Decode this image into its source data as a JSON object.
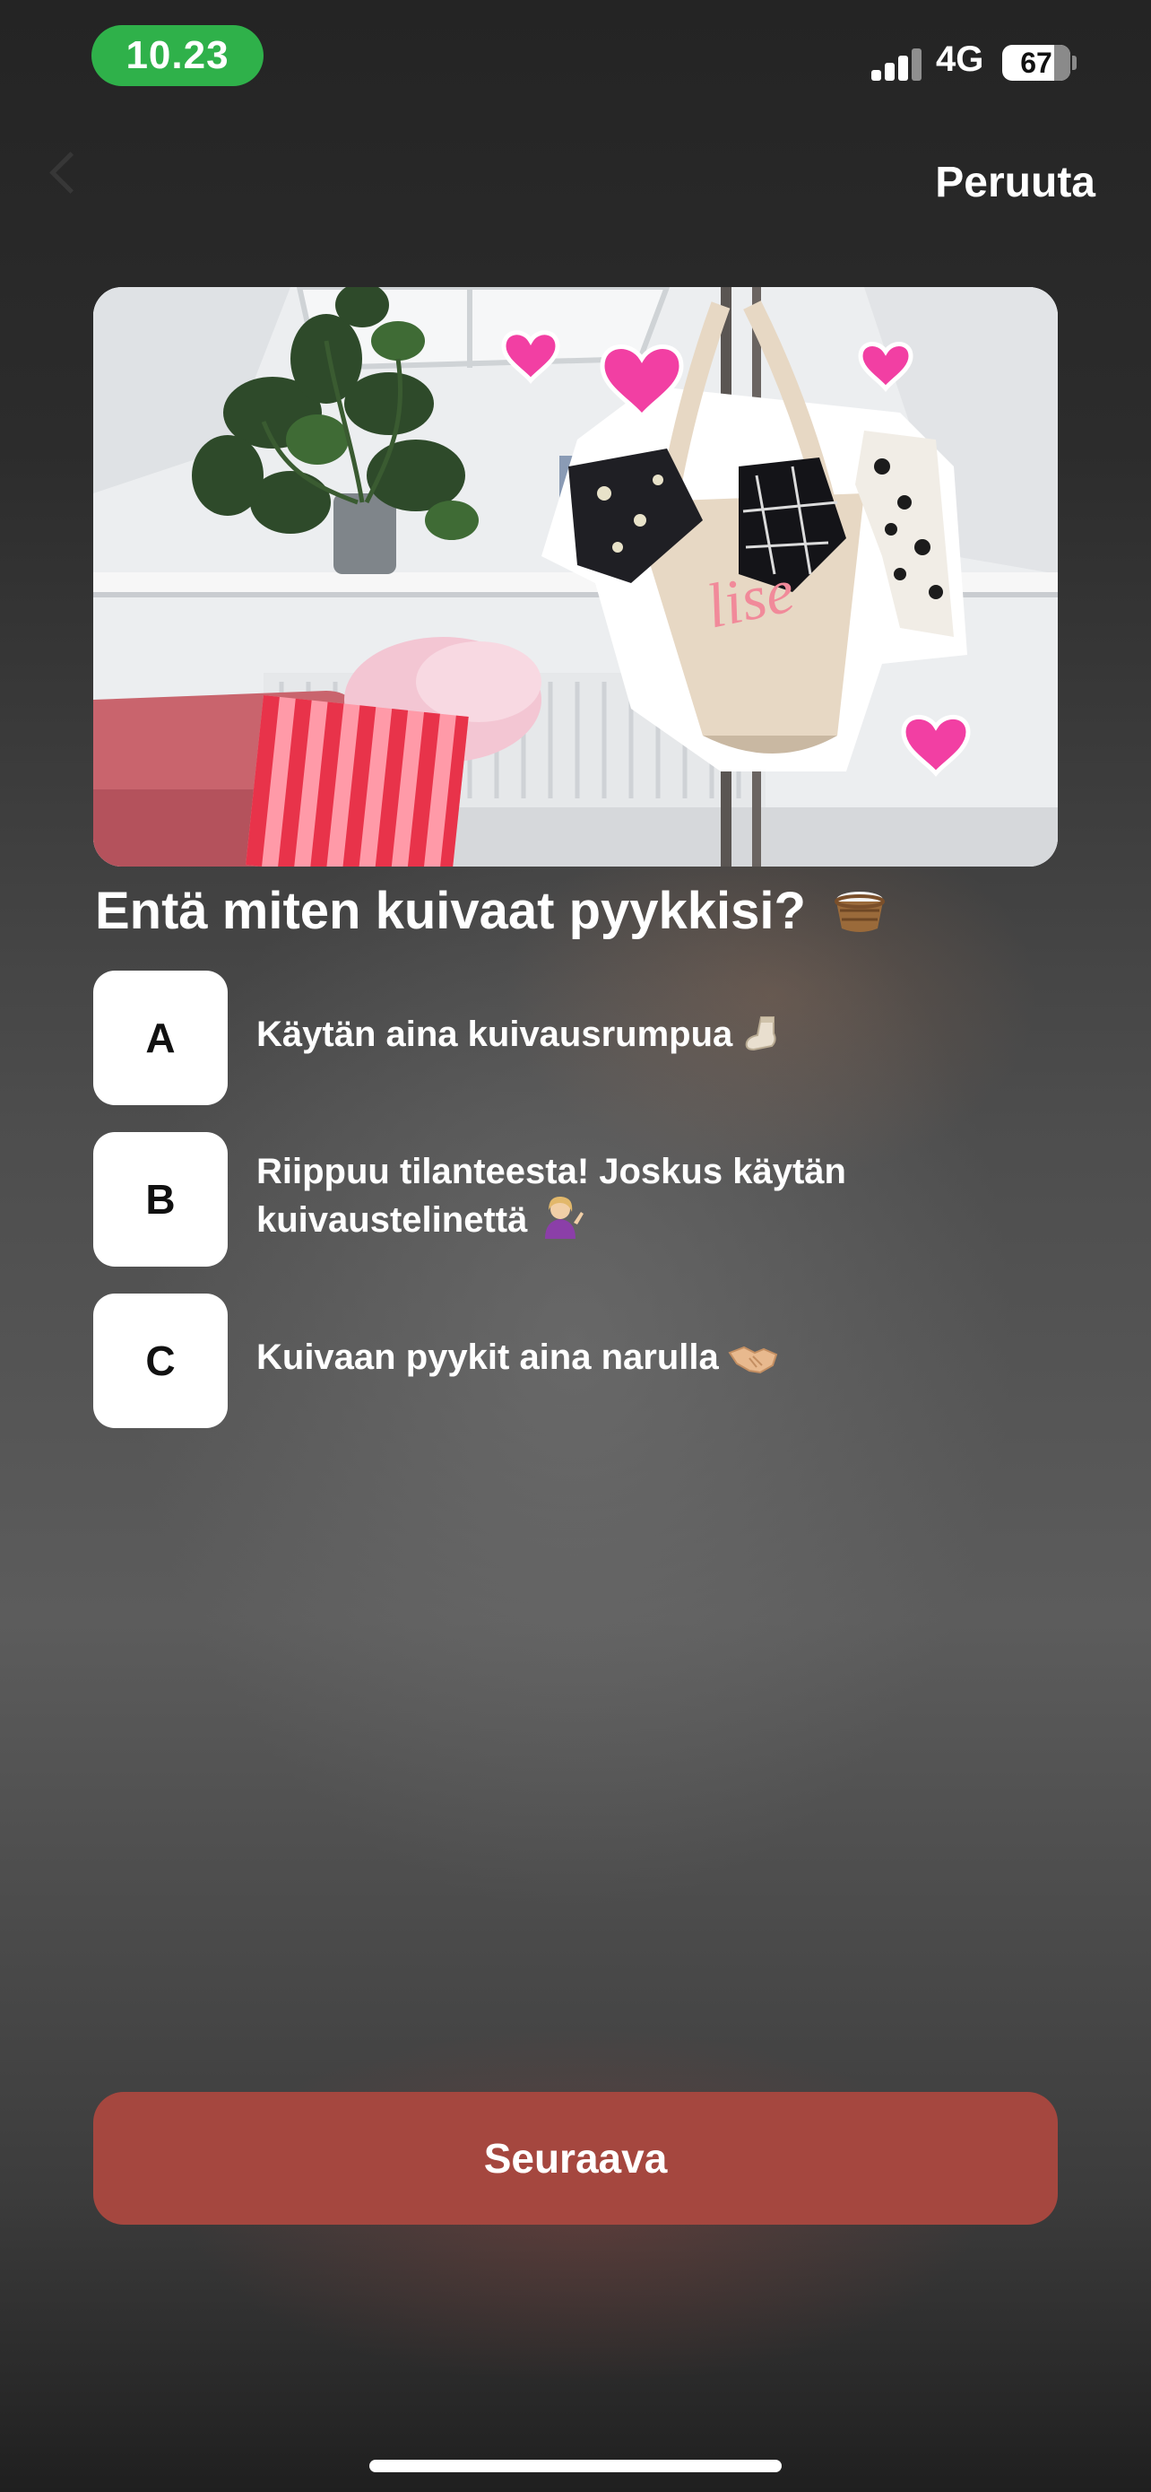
{
  "status_bar": {
    "time": "10.23",
    "network": "4G",
    "battery": "67"
  },
  "header": {
    "cancel_label": "Peruuta"
  },
  "hero_image": {
    "tote_text": "lise",
    "colors": {
      "heart": "#f23fa3",
      "pillow_red": "#e8334a",
      "pillow_pink": "#ff9aa8",
      "sofa": "#c9646d",
      "tote": "#e7d8c4"
    }
  },
  "question": {
    "text": "Entä miten kuivaat pyykkisi?",
    "icon": "laundry-basket-icon"
  },
  "options": [
    {
      "letter": "A",
      "text": "Käytän aina kuivausrumpua",
      "icon": "sock-icon"
    },
    {
      "letter": "B",
      "text": "Riippuu tilanteesta! Joskus käytän kuivaustelinettä",
      "icon": "person-tipping-hand-icon"
    },
    {
      "letter": "C",
      "text": "Kuivaan pyykit aina narulla",
      "icon": "handshake-icon"
    }
  ],
  "footer": {
    "next_label": "Seuraava",
    "accent_color": "#a5473f"
  }
}
